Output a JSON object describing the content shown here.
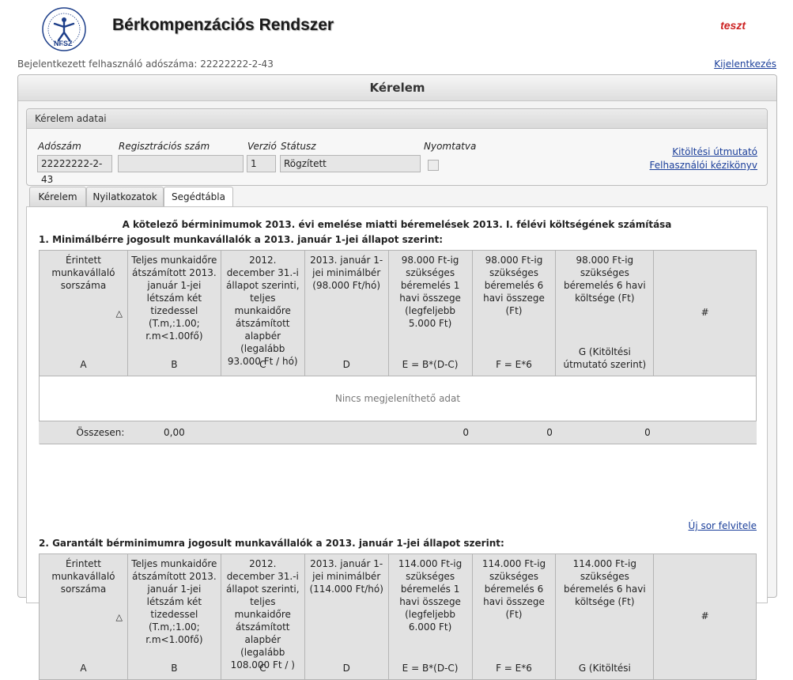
{
  "header": {
    "logo_text": "NFSZ",
    "app_title": "Bérkompenzációs Rendszer",
    "environment": "teszt"
  },
  "userbar": {
    "logged_in_text": "Bejelentkezett felhasználó adószáma: 22222222-2-43",
    "logout_label": "Kijelentkezés"
  },
  "main": {
    "title": "Kérelem"
  },
  "details": {
    "legend": "Kérelem adatai",
    "fields": {
      "tax_label": "Adószám",
      "tax_value": "22222222-2-43",
      "reg_label": "Regisztrációs szám",
      "reg_value": "",
      "version_label": "Verzió",
      "version_value": "1",
      "status_label": "Státusz",
      "status_value": "Rögzített",
      "printed_label": "Nyomtatva",
      "printed_checked": false
    },
    "links": {
      "guide": "Kitöltési útmutató",
      "manual": "Felhasználói kézikönyv"
    }
  },
  "tabs": [
    {
      "label": "Kérelem",
      "active": false
    },
    {
      "label": "Nyilatkozatok",
      "active": false
    },
    {
      "label": "Segédtábla",
      "active": true
    }
  ],
  "report_title": "A kötelező bérminimumok 2013. évi emelése miatti béremelések 2013. I. félévi költségének számítása",
  "section1": {
    "title": "1. Minimálbérre jogosult munkavállalók a 2013. január 1-jei állapot szerint:",
    "columns": [
      {
        "header": "Érintett munkavállaló sorszáma",
        "letter": "A"
      },
      {
        "header": "Teljes munkaidőre átszámított 2013. január 1-jei létszám két tizedessel (T.m,:1.00; r.m<1.00fő)",
        "letter": "B"
      },
      {
        "header": "2012. december 31.-i állapot szerinti, teljes munkaidőre átszámított alapbér (legalább 93.000 Ft / hó)",
        "letter": "C"
      },
      {
        "header": "2013. január 1-jei minimálbér (98.000 Ft/hó)",
        "letter": "D"
      },
      {
        "header": "98.000 Ft-ig szükséges béremelés 1 havi összege (legfeljebb 5.000 Ft)",
        "letter": "E = B*(D-C)"
      },
      {
        "header": "98.000 Ft-ig szükséges béremelés 6 havi összege (Ft)",
        "letter": "F = E*6"
      },
      {
        "header": "98.000 Ft-ig szükséges béremelés 6 havi költsége (Ft)",
        "letter": "G (Kitöltési útmutató szerint)"
      },
      {
        "header": "#",
        "letter": ""
      }
    ],
    "empty_text": "Nincs megjeleníthető adat",
    "totals": {
      "label": "Összesen:",
      "b": "0,00",
      "e": "0",
      "f": "0",
      "g": "0"
    },
    "new_row_label": "Új sor felvitele"
  },
  "section2": {
    "title": "2. Garantált bérminimumra jogosult munkavállalók a 2013. január 1-jei állapot szerint:",
    "columns": [
      {
        "header": "Érintett munkavállaló sorszáma",
        "letter": "A"
      },
      {
        "header": "Teljes munkaidőre átszámított 2013. január 1-jei létszám két tizedessel (T.m,:1.00; r.m<1.00fő)",
        "letter": "B"
      },
      {
        "header": "2012. december 31.-i állapot szerinti, teljes munkaidőre átszámított alapbér (legalább 108.000 Ft / )",
        "letter": "C"
      },
      {
        "header": "2013. január 1-jei minimálbér (114.000 Ft/hó)",
        "letter": "D"
      },
      {
        "header": "114.000 Ft-ig szükséges béremelés 1 havi összege (legfeljebb 6.000 Ft)",
        "letter": "E = B*(D-C)"
      },
      {
        "header": "114.000 Ft-ig szükséges béremelés 6 havi összege (Ft)",
        "letter": "F = E*6"
      },
      {
        "header": "114.000 Ft-ig szükséges béremelés 6 havi költsége (Ft)",
        "letter": "G (Kitöltési"
      },
      {
        "header": "#",
        "letter": ""
      }
    ]
  }
}
